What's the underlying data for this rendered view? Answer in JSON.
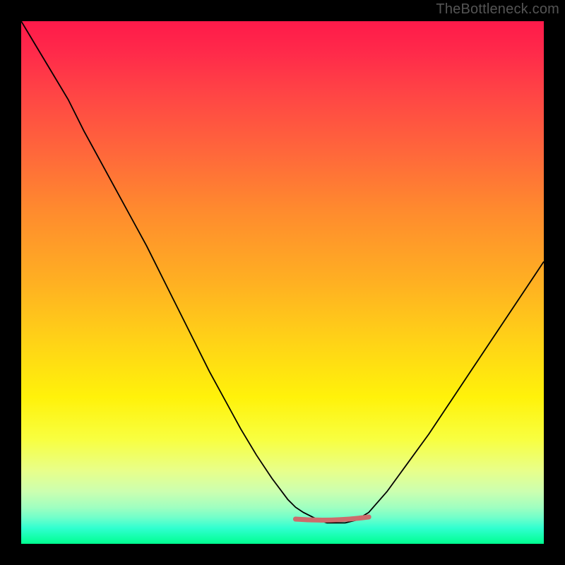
{
  "watermark": "TheBottleneck.com",
  "colors": {
    "frame": "#000000",
    "gradient_stops": [
      {
        "offset": 0,
        "color": "#ff1a4a"
      },
      {
        "offset": 6,
        "color": "#ff2a4a"
      },
      {
        "offset": 14,
        "color": "#ff4545"
      },
      {
        "offset": 26,
        "color": "#ff6a3a"
      },
      {
        "offset": 36,
        "color": "#ff8a2e"
      },
      {
        "offset": 50,
        "color": "#ffb022"
      },
      {
        "offset": 62,
        "color": "#ffd516"
      },
      {
        "offset": 72,
        "color": "#fff20a"
      },
      {
        "offset": 80,
        "color": "#f8ff40"
      },
      {
        "offset": 86,
        "color": "#e8ff8a"
      },
      {
        "offset": 90,
        "color": "#ccffb0"
      },
      {
        "offset": 93,
        "color": "#a0ffc0"
      },
      {
        "offset": 95,
        "color": "#70ffca"
      },
      {
        "offset": 97,
        "color": "#30ffd0"
      },
      {
        "offset": 100,
        "color": "#00ff90"
      }
    ],
    "curve_stroke": "#000000",
    "flat_segment_stroke": "#cc6c6c"
  },
  "chart_data": {
    "type": "line",
    "title": "",
    "xlabel": "",
    "ylabel": "",
    "xlim": [
      0,
      100
    ],
    "ylim": [
      0,
      100
    ],
    "x": [
      0,
      3,
      6,
      9,
      12,
      15,
      18,
      21,
      24,
      27,
      30,
      33,
      36,
      39,
      42,
      45,
      48,
      51,
      52.5,
      54,
      57,
      58.5,
      60,
      62,
      64,
      66.5,
      70,
      74,
      78,
      82,
      86,
      90,
      94,
      98,
      100
    ],
    "values": [
      100,
      95,
      90,
      85,
      79,
      73.5,
      68,
      62.5,
      57,
      51,
      45,
      39,
      33,
      27.5,
      22,
      17,
      12.5,
      8.5,
      7,
      6,
      4.5,
      4,
      4,
      4,
      4.5,
      6,
      10,
      15.5,
      21,
      27,
      33,
      39,
      45,
      51,
      54
    ],
    "flat_segment": {
      "x_start": 52.5,
      "x_end": 66.5,
      "y": 5
    }
  }
}
